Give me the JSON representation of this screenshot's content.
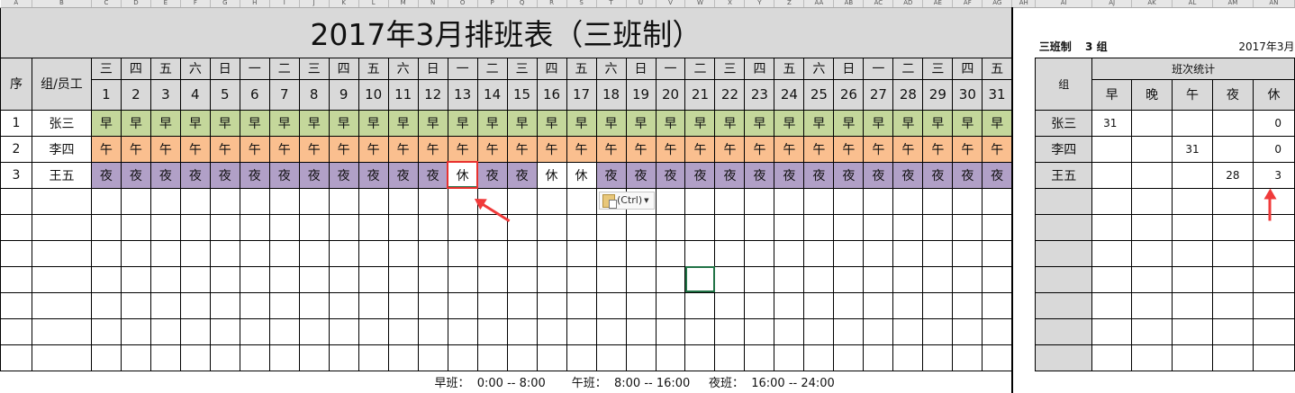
{
  "column_letters": [
    "A",
    "B",
    "C",
    "D",
    "E",
    "F",
    "G",
    "H",
    "I",
    "J",
    "K",
    "L",
    "M",
    "N",
    "O",
    "P",
    "Q",
    "R",
    "S",
    "T",
    "U",
    "V",
    "W",
    "X",
    "Y",
    "Z",
    "AA",
    "AB",
    "AC",
    "AD",
    "AE",
    "AF",
    "AG",
    "AH",
    "AI",
    "AJ",
    "AK",
    "AL",
    "AM",
    "AN"
  ],
  "title": "2017年3月排班表（三班制）",
  "headers": {
    "seq": "序",
    "group": "组/员工"
  },
  "weekdays": [
    "三",
    "四",
    "五",
    "六",
    "日",
    "一",
    "二",
    "三",
    "四",
    "五",
    "六",
    "日",
    "一",
    "二",
    "三",
    "四",
    "五",
    "六",
    "日",
    "一",
    "二",
    "三",
    "四",
    "五",
    "六",
    "日",
    "一",
    "二",
    "三",
    "四",
    "五"
  ],
  "days": [
    "1",
    "2",
    "3",
    "4",
    "5",
    "6",
    "7",
    "8",
    "9",
    "10",
    "11",
    "12",
    "13",
    "14",
    "15",
    "16",
    "17",
    "18",
    "19",
    "20",
    "21",
    "22",
    "23",
    "24",
    "25",
    "26",
    "27",
    "28",
    "29",
    "30",
    "31"
  ],
  "shift_colors": {
    "早": "#c4d79b",
    "午": "#fabf8f",
    "夜": "#b1a0c7",
    "休": "#ffffff"
  },
  "employees": [
    {
      "seq": "1",
      "name": "张三",
      "default": "早",
      "shifts": [
        "早",
        "早",
        "早",
        "早",
        "早",
        "早",
        "早",
        "早",
        "早",
        "早",
        "早",
        "早",
        "早",
        "早",
        "早",
        "早",
        "早",
        "早",
        "早",
        "早",
        "早",
        "早",
        "早",
        "早",
        "早",
        "早",
        "早",
        "早",
        "早",
        "早",
        "早"
      ]
    },
    {
      "seq": "2",
      "name": "李四",
      "default": "午",
      "shifts": [
        "午",
        "午",
        "午",
        "午",
        "午",
        "午",
        "午",
        "午",
        "午",
        "午",
        "午",
        "午",
        "午",
        "午",
        "午",
        "午",
        "午",
        "午",
        "午",
        "午",
        "午",
        "午",
        "午",
        "午",
        "午",
        "午",
        "午",
        "午",
        "午",
        "午",
        "午"
      ]
    },
    {
      "seq": "3",
      "name": "王五",
      "default": "夜",
      "shifts": [
        "夜",
        "夜",
        "夜",
        "夜",
        "夜",
        "夜",
        "夜",
        "夜",
        "夜",
        "夜",
        "夜",
        "夜",
        "休",
        "夜",
        "夜",
        "休",
        "休",
        "夜",
        "夜",
        "夜",
        "夜",
        "夜",
        "夜",
        "夜",
        "夜",
        "夜",
        "夜",
        "夜",
        "夜",
        "夜",
        "夜"
      ]
    }
  ],
  "legend": "早班：  0:00 -- 8:00       午班：  8:00 -- 16:00     夜班：  16:00 -- 24:00",
  "paste_options": "(Ctrl)",
  "summary": {
    "label": "三班制",
    "groups": "3 组",
    "month": "2017年3月",
    "group_header": "组",
    "stats_header": "班次统计",
    "columns": [
      "早",
      "晚",
      "午",
      "夜",
      "休"
    ],
    "rows": [
      {
        "name": "张三",
        "values": [
          "31",
          "",
          "",
          "",
          "0"
        ]
      },
      {
        "name": "李四",
        "values": [
          "",
          "",
          "31",
          "",
          "0"
        ]
      },
      {
        "name": "王五",
        "values": [
          "",
          "",
          "",
          "28",
          "3"
        ]
      }
    ]
  }
}
